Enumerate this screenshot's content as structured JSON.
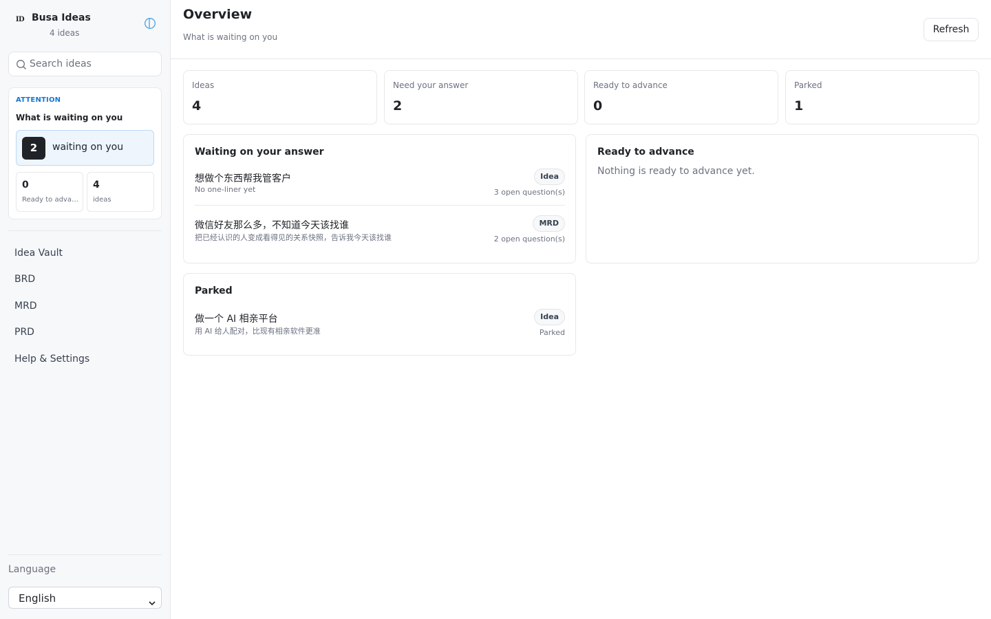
{
  "sidebar": {
    "brand": {
      "logo": "ID",
      "name": "Busa Ideas",
      "count": "4 ideas"
    },
    "collapse_icon": "panel-toggle-icon",
    "search": {
      "placeholder": "Search ideas",
      "icon": "search-icon"
    },
    "attention": {
      "kicker": "ATTENTION",
      "title": "What is waiting on you",
      "waiting_count": "2",
      "waiting_label": "waiting on you",
      "mini": [
        {
          "value": "0",
          "label": "Ready to advance"
        },
        {
          "value": "4",
          "label": "ideas"
        }
      ]
    },
    "nav": [
      {
        "label": "Idea Vault"
      },
      {
        "label": "BRD"
      },
      {
        "label": "MRD"
      },
      {
        "label": "PRD"
      },
      {
        "label": "Help & Settings"
      }
    ],
    "language": {
      "label": "Language",
      "selected": "English"
    }
  },
  "header": {
    "title": "Overview",
    "subtitle": "What is waiting on you",
    "refresh_label": "Refresh"
  },
  "stats": [
    {
      "label": "Ideas",
      "value": "4"
    },
    {
      "label": "Need your answer",
      "value": "2"
    },
    {
      "label": "Ready to advance",
      "value": "0"
    },
    {
      "label": "Parked",
      "value": "1"
    }
  ],
  "waiting_card": {
    "title": "Waiting on your answer",
    "items": [
      {
        "title": "想做个东西帮我管客户",
        "subtitle": "No one-liner yet",
        "tag": "Idea",
        "meta": "3 open question(s)"
      },
      {
        "title": "微信好友那么多，不知道今天该找谁",
        "subtitle": "把已经认识的人变成看得见的关系快照，告诉我今天该找谁",
        "tag": "MRD",
        "meta": "2 open question(s)"
      }
    ]
  },
  "ready_card": {
    "title": "Ready to advance",
    "empty": "Nothing is ready to advance yet."
  },
  "parked_card": {
    "title": "Parked",
    "items": [
      {
        "title": "做一个 AI 相亲平台",
        "subtitle": "用 AI 给人配对，比现有相亲软件更准",
        "tag": "Idea",
        "meta": "Parked"
      }
    ]
  },
  "colors": {
    "accent": "#1677d2",
    "sidebar_bg": "#f7f8f9",
    "border": "#e6e8eb",
    "text": "#1f2328",
    "muted": "#6b7280",
    "highlight_bg": "#eef5fd"
  }
}
